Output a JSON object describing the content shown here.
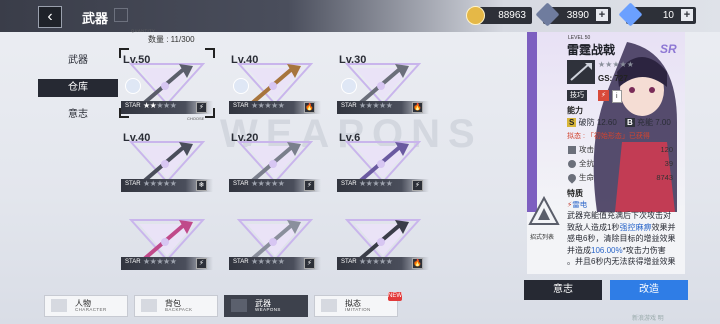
{
  "header": {
    "title": "武器",
    "back_icon": "back-arrow-icon",
    "currencies": [
      {
        "name": "coin",
        "icon": "coin-icon",
        "value": "88963",
        "color": "#e5b847",
        "plus": "",
        "has_plus": false
      },
      {
        "name": "crystal",
        "icon": "crystal-icon",
        "value": "3890",
        "color": "#6f7c9e",
        "plus": "+",
        "has_plus": true
      },
      {
        "name": "gem",
        "icon": "gem-icon",
        "value": "10",
        "color": "#6ba0ff",
        "plus": "+",
        "has_plus": true
      }
    ]
  },
  "nav": {
    "items": [
      {
        "label": "武器"
      },
      {
        "label": "仓库",
        "active": true
      },
      {
        "label": "意志"
      }
    ]
  },
  "capacity": {
    "caption": "QUANTITY",
    "label": "数量 : 11/300"
  },
  "weapons": [
    {
      "level": "Lv.50",
      "stars": 5,
      "filled": 2,
      "badge": "⚡",
      "selected": true,
      "avatar": true,
      "choose": "CHOOSE"
    },
    {
      "level": "Lv.40",
      "stars": 5,
      "filled": 0,
      "badge": "🔥",
      "selected": false,
      "avatar": true
    },
    {
      "level": "Lv.30",
      "stars": 5,
      "filled": 0,
      "badge": "🔥",
      "selected": false,
      "avatar": true
    },
    {
      "level": "Lv.40",
      "stars": 5,
      "filled": 0,
      "badge": "❄",
      "selected": false,
      "avatar": false
    },
    {
      "level": "Lv.20",
      "stars": 5,
      "filled": 0,
      "badge": "⚡",
      "selected": false,
      "avatar": false
    },
    {
      "level": "Lv.6",
      "stars": 5,
      "filled": 0,
      "badge": "⚡",
      "selected": false,
      "avatar": false
    },
    {
      "level": "",
      "stars": 5,
      "filled": 0,
      "badge": "⚡",
      "selected": false,
      "avatar": false
    },
    {
      "level": "",
      "stars": 5,
      "filled": 0,
      "badge": "⚡",
      "selected": false,
      "avatar": false
    },
    {
      "level": "",
      "stars": 5,
      "filled": 0,
      "badge": "🔥",
      "selected": false,
      "avatar": false
    }
  ],
  "detail": {
    "level_label": "LEVEL 50",
    "name": "雷霆战戟",
    "rarity": "SR",
    "gs": "GS: 727",
    "tags": [
      "技巧",
      "⚡"
    ],
    "ability_header": "能力",
    "shatter_label": "破防",
    "shatter_value": "12.60",
    "charge_label": "充能",
    "charge_value": "7.00",
    "advance_note": "拟态 : 「初始形态」已获得",
    "stats": [
      {
        "label": "攻击",
        "value": "120",
        "icon": "sword-icon"
      },
      {
        "label": "全抗",
        "value": "39",
        "icon": "shield-icon"
      },
      {
        "label": "生命",
        "value": "8743",
        "icon": "heart-icon"
      }
    ],
    "trait_header": "特质",
    "element": "雷电",
    "emblem_label": "招式列表",
    "trait_lines": [
      {
        "t": "武器充能值充满后下次攻击对"
      },
      {
        "t": "致敌人造成1秒",
        "h": "强控麻痹",
        "t2": "效果并"
      },
      {
        "t": "感电6秒，清除目标的增益效果"
      },
      {
        "t": "并造成",
        "h": "106.00%",
        "t2": "*攻击力伤害"
      },
      {
        "t": "。并且6秒内无法获得增益效果"
      }
    ]
  },
  "actions": {
    "will_label": "意志",
    "modify_label": "改造"
  },
  "bottom_tabs": [
    {
      "cn": "人物",
      "en": "CHARACTER"
    },
    {
      "cn": "背包",
      "en": "BACKPACK"
    },
    {
      "cn": "武器",
      "en": "WEAPONS",
      "active": true
    },
    {
      "cn": "拟态",
      "en": "IMITATION"
    }
  ],
  "new_badge": "NEW",
  "watermark": "新浪游戏 明",
  "colors": {
    "accent": "#2f7de6",
    "dark": "#262933",
    "rarity": "#8e78d4"
  }
}
